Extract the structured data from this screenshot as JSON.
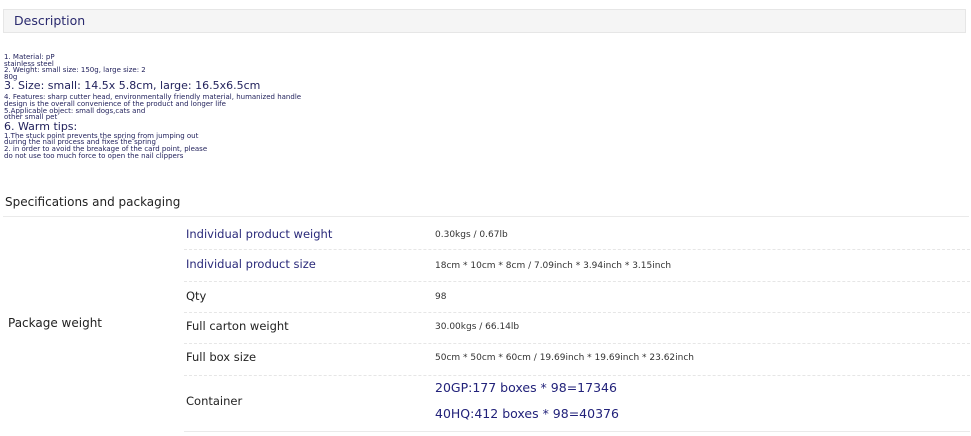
{
  "description": {
    "header": "Description",
    "lines_top": [
      "1. Material: pP",
      "stainless steel",
      "2. Weight: small size: 150g, large size: 2",
      "80g"
    ],
    "size_line": "3. Size: small: 14.5x 5.8cm, large: 16.5x6.5cm",
    "lines_mid": [
      "4. Features: sharp cutter head, environmentally friendly material, humanized handle",
      "design is the overall convenience of the product and longer life",
      "5.Applicable object: small dogs,cats and",
      "other small pet"
    ],
    "warm_title": "6. Warm tips:",
    "lines_bottom": [
      "1.The stuck point prevents the spring from jumping out",
      "during the nail process and fixes the spring",
      "2. in order to avoid the breakage of the card point, please",
      "do not use too much force to open the nail clippers"
    ]
  },
  "specs": {
    "title": "Specifications and packaging",
    "package_label": "Package weight",
    "rows": [
      {
        "key": "Individual product weight",
        "value": "0.30kgs / 0.67lb"
      },
      {
        "key": "Individual product size",
        "value": "18cm * 10cm * 8cm / 7.09inch * 3.94inch * 3.15inch"
      },
      {
        "key": "Qty",
        "value": "98"
      },
      {
        "key": "Full carton weight",
        "value": "30.00kgs / 66.14lb"
      },
      {
        "key": "Full box size",
        "value": "50cm * 50cm * 60cm / 19.69inch * 19.69inch * 23.62inch"
      }
    ],
    "container": {
      "key": "Container",
      "values": [
        "20GP:177 boxes * 98=17346",
        "40HQ:412 boxes * 98=40376"
      ]
    }
  }
}
